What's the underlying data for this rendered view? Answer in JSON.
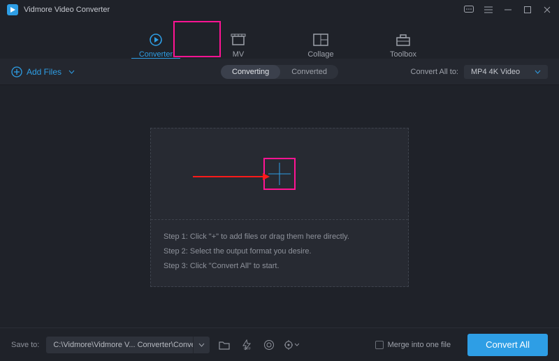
{
  "titlebar": {
    "title": "Vidmore Video Converter"
  },
  "nav": {
    "items": [
      {
        "label": "Converter",
        "active": true
      },
      {
        "label": "MV",
        "active": false
      },
      {
        "label": "Collage",
        "active": false
      },
      {
        "label": "Toolbox",
        "active": false
      }
    ]
  },
  "secbar": {
    "add_label": "Add Files",
    "tabs": {
      "converting": "Converting",
      "converted": "Converted",
      "active": "converting"
    },
    "convert_all_to_label": "Convert All to:",
    "format_selected": "MP4 4K Video"
  },
  "dropzone": {
    "steps": [
      "Step 1: Click \"+\" to add files or drag them here directly.",
      "Step 2: Select the output format you desire.",
      "Step 3: Click \"Convert All\" to start."
    ]
  },
  "footer": {
    "save_to_label": "Save to:",
    "path": "C:\\Vidmore\\Vidmore V... Converter\\Converted",
    "merge_label": "Merge into one file",
    "convert_label": "Convert All"
  },
  "colors": {
    "accent": "#2e9ee5",
    "highlight": "#ff1493"
  }
}
